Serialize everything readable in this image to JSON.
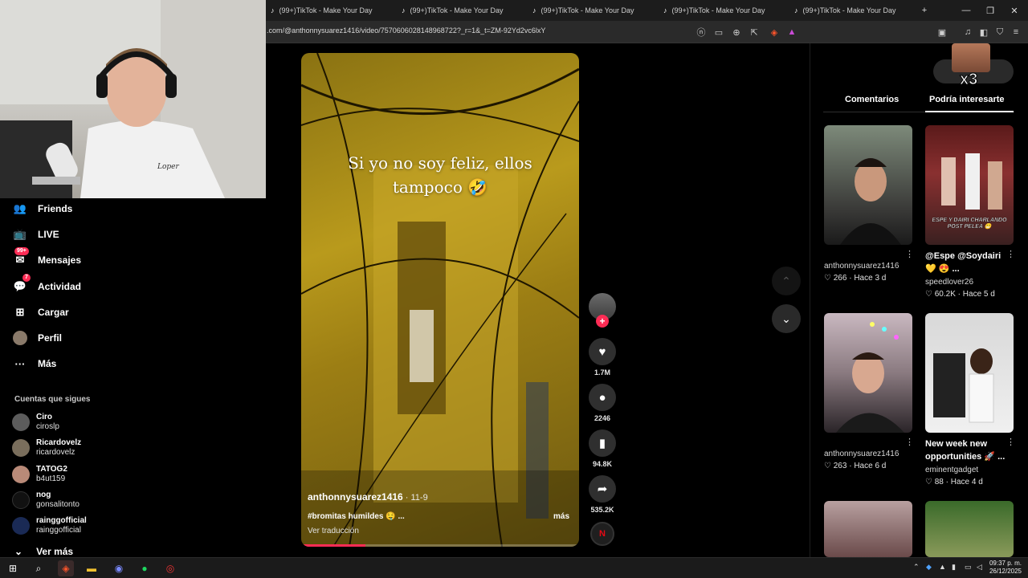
{
  "browser": {
    "tabs": [
      {
        "title": "(99+)TikTok - Make Your Day"
      },
      {
        "title": "(99+)TikTok - Make Your Day"
      },
      {
        "title": "(99+)TikTok - Make Your Day"
      },
      {
        "title": "(99+)TikTok - Make Your Day"
      },
      {
        "title": "(99+)TikTok - Make Your Day"
      }
    ],
    "new_tab": "+",
    "url": ".com/@anthonnysuarez1416/video/7570606028148968722?_r=1&_t=ZM-92Yd2vc6lxY"
  },
  "sidebar": {
    "items": [
      {
        "label": "Friends",
        "icon": "friends-icon"
      },
      {
        "label": "LIVE",
        "icon": "live-icon"
      },
      {
        "label": "Mensajes",
        "icon": "messages-icon",
        "badge": "99+"
      },
      {
        "label": "Actividad",
        "icon": "activity-icon",
        "badge": "7"
      },
      {
        "label": "Cargar",
        "icon": "upload-icon"
      },
      {
        "label": "Perfil",
        "icon": "profile-icon"
      },
      {
        "label": "Más",
        "icon": "more-icon"
      }
    ],
    "following_title": "Cuentas que sigues",
    "following": [
      {
        "display": "Ciro",
        "user": "ciroslp"
      },
      {
        "display": "Ricardovelz",
        "user": "ricardovelz"
      },
      {
        "display": "TATOG2",
        "user": "b4ut159"
      },
      {
        "display": "nog",
        "user": "gonsalitonto"
      },
      {
        "display": "rainggofficial",
        "user": "rainggofficial"
      }
    ],
    "see_more": "Ver más"
  },
  "video": {
    "overlay_text_line1": "Si yo no soy feliz, ellos",
    "overlay_text_line2": "tampoco 🤣",
    "author": "anthonnysuarez1416",
    "date": " · 11-9",
    "caption": "#bromitas humildes 🤤 ...",
    "more": "más",
    "translate": "Ver traducción",
    "progress": 0.23
  },
  "actions": {
    "likes": "1.7M",
    "comments": "2246",
    "saves": "94.8K",
    "shares": "535.2K"
  },
  "right_panel": {
    "tab_comments": "Comentarios",
    "tab_suggested": "Podría interesarte",
    "overlay_badge": "x3",
    "cards": [
      {
        "title": "",
        "user": "anthonnysuarez1416",
        "likes": "266",
        "age": "Hace 3 d",
        "thumb_caption": ""
      },
      {
        "title": "@Espe @Soydairi 💛 😍 ...",
        "user": "speedlover26",
        "likes": "60.2K",
        "age": "Hace 5 d",
        "thumb_caption": "ESPE Y DAIRI CHARLANDO POST PELEA 😁"
      },
      {
        "title": "",
        "user": "anthonnysuarez1416",
        "likes": "263",
        "age": "Hace 6 d",
        "thumb_caption": ""
      },
      {
        "title": "New week new opportunities 🚀 ...",
        "user": "eminentgadget",
        "likes": "88",
        "age": "Hace 4 d",
        "thumb_caption": ""
      }
    ]
  },
  "taskbar": {
    "time": "09:37 p. m.",
    "date": "26/12/2025"
  },
  "colors": {
    "accent": "#fe2c55",
    "background": "#000000"
  }
}
